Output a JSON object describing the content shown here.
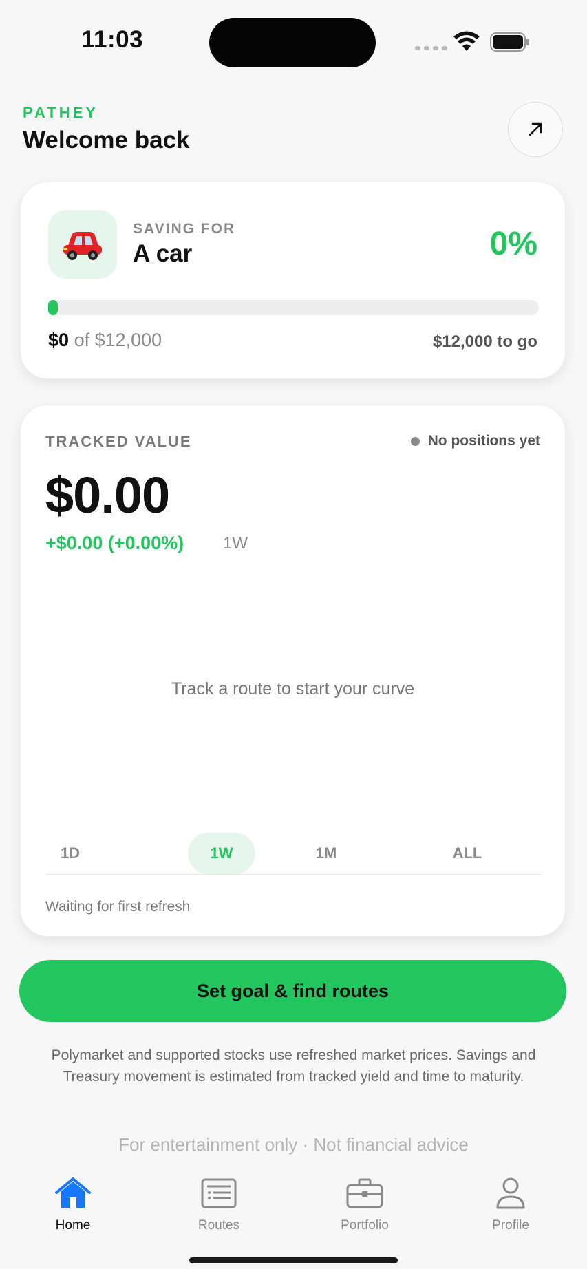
{
  "status_bar": {
    "time": "11:03"
  },
  "header": {
    "brand": "PATHEY",
    "title": "Welcome back"
  },
  "goal": {
    "label": "SAVING FOR",
    "emoji": "🚗",
    "name": "A car",
    "percent_text": "0%",
    "progress_fraction": 0.0,
    "saved": "$0",
    "of_target": "of $12,000",
    "to_go": "$12,000 to go"
  },
  "tracked": {
    "label": "TRACKED VALUE",
    "status": "No positions yet",
    "value": "$0.00",
    "change": "+$0.00 (+0.00%)",
    "change_period": "1W",
    "empty_message": "Track a route to start your curve",
    "ranges": [
      "1D",
      "1W",
      "1M",
      "ALL"
    ],
    "active_range": "1W",
    "footer": "Waiting for first refresh"
  },
  "cta": {
    "label": "Set goal & find routes"
  },
  "disclaimer": "Polymarket and supported stocks use refreshed market prices. Savings and Treasury movement is estimated from tracked yield and time to maturity.",
  "entertainment": "For entertainment only · Not financial advice",
  "tabbar": {
    "items": [
      {
        "label": "Home",
        "icon": "house-icon",
        "active": true
      },
      {
        "label": "Routes",
        "icon": "list-icon",
        "active": false
      },
      {
        "label": "Portfolio",
        "icon": "briefcase-icon",
        "active": false
      },
      {
        "label": "Profile",
        "icon": "person-icon",
        "active": false
      }
    ]
  },
  "colors": {
    "accent": "#22c55e",
    "accent_bg": "#e6f6ec",
    "tab_active": "#1677ff"
  }
}
